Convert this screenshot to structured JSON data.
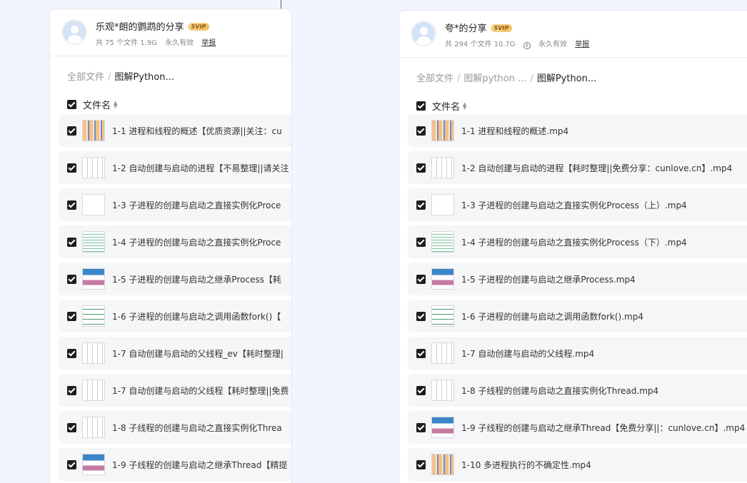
{
  "left_panel": {
    "title": "乐观*朗的鹦鹉的分享",
    "badge": "SVIP",
    "file_count": "共 75 个文件 1.9G",
    "validity": "永久有效",
    "report": "举报",
    "breadcrumb": [
      "全部文件",
      "图解Python..."
    ],
    "column_header": "文件名",
    "files": [
      {
        "name": "1-1 进程和线程的概述【优质资源||关注：cu",
        "thumb": "orange"
      },
      {
        "name": "1-2 自动创建与启动的进程【不易整理||请关注",
        "thumb": "lines"
      },
      {
        "name": "1-3 子进程的创建与启动之直接实例化Proce",
        "thumb": "blank"
      },
      {
        "name": "1-4 子进程的创建与启动之直接实例化Proce",
        "thumb": "green"
      },
      {
        "name": "1-5 子进程的创建与启动之继承Process【耗",
        "thumb": "blocks"
      },
      {
        "name": "1-6 子进程的创建与启动之调用函数fork()【",
        "thumb": "text"
      },
      {
        "name": "1-7 自动创建与启动的父线程_ev【耗时整理|",
        "thumb": "lines"
      },
      {
        "name": "1-7 自动创建与启动的父线程【耗时整理||免费",
        "thumb": "lines"
      },
      {
        "name": "1-8 子线程的创建与启动之直接实例化Threa",
        "thumb": "lines"
      },
      {
        "name": "1-9 子线程的创建与启动之继承Thread【精提",
        "thumb": "blocks"
      }
    ]
  },
  "right_panel": {
    "title": "夸*的分享",
    "badge": "SVIP",
    "file_count": "共 294 个文件 10.7G",
    "validity": "永久有效",
    "report": "举报",
    "breadcrumb": [
      "全部文件",
      "图解python ...",
      "图解Python..."
    ],
    "column_header": "文件名",
    "files": [
      {
        "name": "1-1 进程和线程的概述.mp4",
        "thumb": "orange"
      },
      {
        "name": "1-2 自动创建与启动的进程【耗时整理||免费分享：cunlove.cn】.mp4",
        "thumb": "lines"
      },
      {
        "name": "1-3 子进程的创建与启动之直接实例化Process（上）.mp4",
        "thumb": "blank"
      },
      {
        "name": "1-4 子进程的创建与启动之直接实例化Process（下）.mp4",
        "thumb": "green"
      },
      {
        "name": "1-5 子进程的创建与启动之继承Process.mp4",
        "thumb": "blocks"
      },
      {
        "name": "1-6 子进程的创建与启动之调用函数fork().mp4",
        "thumb": "text"
      },
      {
        "name": "1-7 自动创建与启动的父线程.mp4",
        "thumb": "lines"
      },
      {
        "name": "1-8 子线程的创建与启动之直接实例化Thread.mp4",
        "thumb": "lines"
      },
      {
        "name": "1-9 子线程的创建与启动之继承Thread【免费分享||：cunlove.cn】.mp4",
        "thumb": "blocks"
      },
      {
        "name": "1-10 多进程执行的不确定性.mp4",
        "thumb": "orange"
      }
    ]
  }
}
